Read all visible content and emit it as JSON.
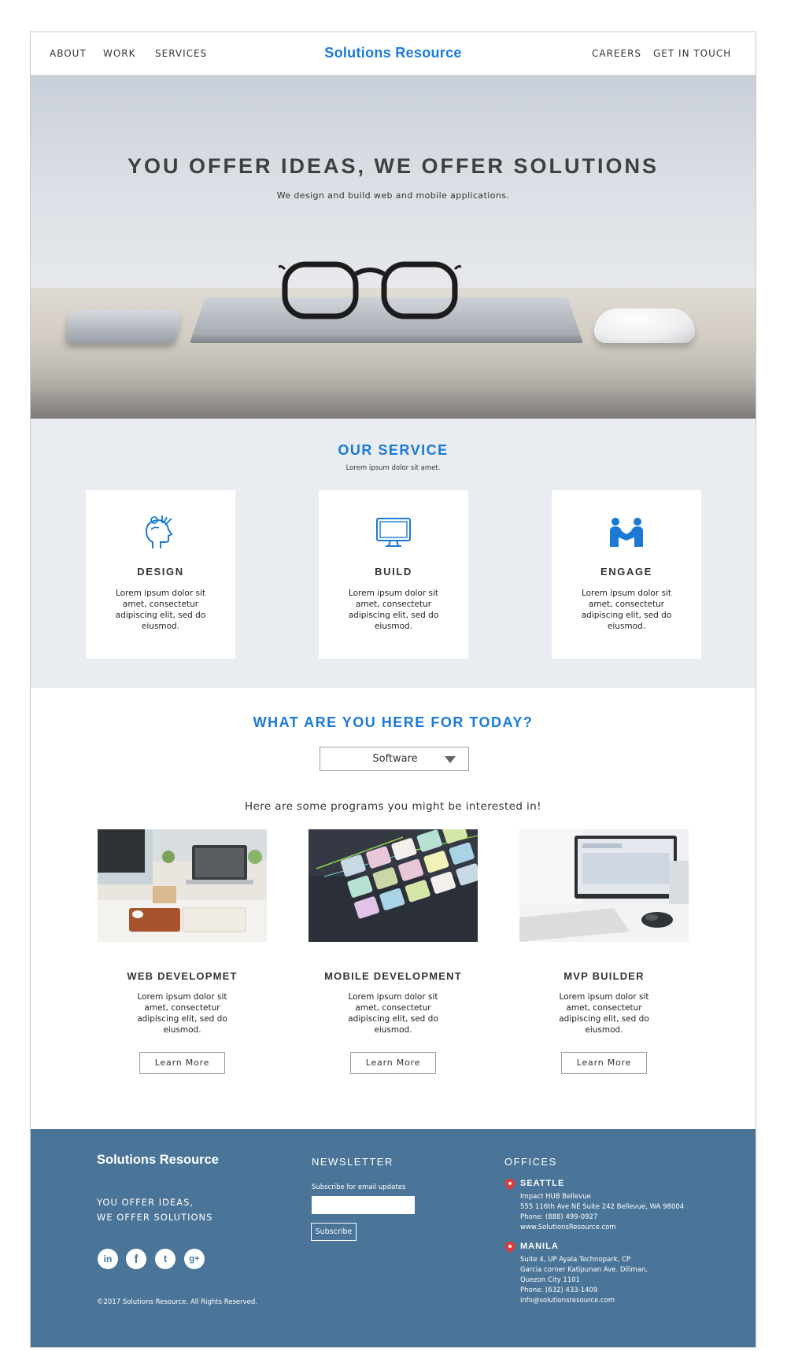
{
  "nav": {
    "left": [
      "ABOUT",
      "WORK",
      "SERVICES"
    ],
    "brand": "Solutions Resource",
    "right": [
      "CAREERS",
      "GET IN TOUCH"
    ]
  },
  "hero": {
    "title": "YOU OFFER IDEAS, WE OFFER SOLUTIONS",
    "subtitle": "We design and build web and mobile applications."
  },
  "service": {
    "title": "OUR SERVICE",
    "subtitle": "Lorem ipsum dolor sit amet.",
    "cards": [
      {
        "icon": "head-ideas-icon",
        "title": "DESIGN",
        "text": "Lorem ipsum dolor sit amet, consectetur adipiscing elit, sed do eiusmod."
      },
      {
        "icon": "monitor-icon",
        "title": "BUILD",
        "text": "Lorem ipsum dolor sit amet, consectetur adipiscing elit, sed do eiusmod."
      },
      {
        "icon": "handshake-icon",
        "title": "ENGAGE",
        "text": "Lorem ipsum dolor sit amet, consectetur adipiscing elit, sed do eiusmod."
      }
    ]
  },
  "programs": {
    "title": "WHAT ARE YOU HERE FOR TODAY?",
    "select_value": "Software",
    "lead": "Here are some programs you might be interested in!",
    "items": [
      {
        "title": "WEB DEVELOPMET",
        "text": "Lorem ipsum dolor sit amet, consectetur adipiscing elit, sed do eiusmod.",
        "button": "Learn More"
      },
      {
        "title": "MOBILE DEVELOPMENT",
        "text": "Lorem ipsum dolor sit amet, consectetur adipiscing elit, sed do eiusmod.",
        "button": "Learn More"
      },
      {
        "title": "MVP BUILDER",
        "text": "Lorem ipsum dolor sit amet, consectetur adipiscing elit, sed do eiusmod.",
        "button": "Learn More"
      }
    ]
  },
  "footer": {
    "brand": "Solutions Resource",
    "tagline": [
      "YOU OFFER IDEAS,",
      "WE OFFER SOLUTIONS"
    ],
    "social": [
      {
        "icon": "linkedin-icon",
        "glyph": "in"
      },
      {
        "icon": "facebook-icon",
        "glyph": "f"
      },
      {
        "icon": "twitter-icon",
        "glyph": "t"
      },
      {
        "icon": "google-plus-icon",
        "glyph": "g+"
      }
    ],
    "copyright": "©2017 Solutions Resource. All Rights Reserved.",
    "newsletter": {
      "title": "NEWSLETTER",
      "label": "Subscribe for  email updates",
      "input_value": "",
      "button": "Subscribe"
    },
    "offices": {
      "title": "OFFICES",
      "locations": [
        {
          "city": "SEATTLE",
          "lines": [
            "Impact HUB Bellevue",
            "555 116th Ave NE Suite 242 Bellevue, WA 98004",
            "Phone: (888) 499-0927",
            "www.SolutionsResource.com"
          ]
        },
        {
          "city": "MANILA",
          "lines": [
            "Suite 4, UP Ayala Technopark, CP",
            "Garcia corner Katipunan Ave. Diliman,",
            "Quezon City 1101",
            "Phone: (632) 433-1409",
            "info@solutionsresource.com"
          ]
        }
      ]
    }
  },
  "colors": {
    "accent": "#1a7ad6",
    "service_bg": "#e9ecf1",
    "footer_bg": "#4a7598",
    "pin": "#e53935"
  }
}
